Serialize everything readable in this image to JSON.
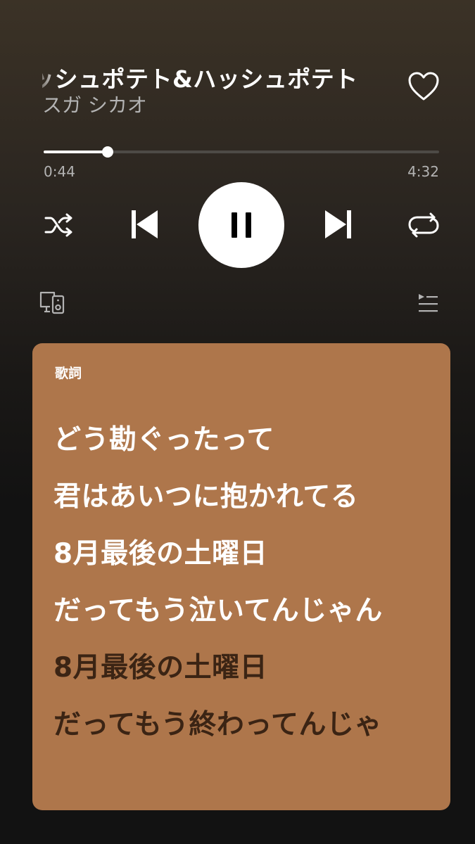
{
  "track": {
    "title": "ッシュポテト&ハッシュポテト",
    "artist": "スガ シカオ",
    "liked": false
  },
  "playback": {
    "elapsed": "0:44",
    "total": "4:32",
    "progress": 0.162,
    "is_playing": true
  },
  "icons": {
    "like": "heart-outline-icon",
    "shuffle": "shuffle-icon",
    "previous": "skip-previous-icon",
    "pause": "pause-icon",
    "next": "skip-next-icon",
    "repeat": "repeat-icon",
    "devices": "connect-devices-icon",
    "queue": "queue-icon"
  },
  "lyrics": {
    "label": "歌詞",
    "lines": [
      {
        "text": "どう勘ぐったって",
        "state": "past"
      },
      {
        "text": "君はあいつに抱かれてる",
        "state": "past"
      },
      {
        "text": "8月最後の土曜日",
        "state": "past"
      },
      {
        "text": "だってもう泣いてんじゃん",
        "state": "past"
      },
      {
        "text": "8月最後の土曜日",
        "state": "upcoming"
      },
      {
        "text": "だってもう終わってんじゃ",
        "state": "upcoming"
      }
    ]
  },
  "colors": {
    "lyrics_card": "#ae764b",
    "lyric_past": "#ffffff",
    "lyric_upcoming": "#3b2414",
    "secondary_text": "#b3b3b3"
  }
}
